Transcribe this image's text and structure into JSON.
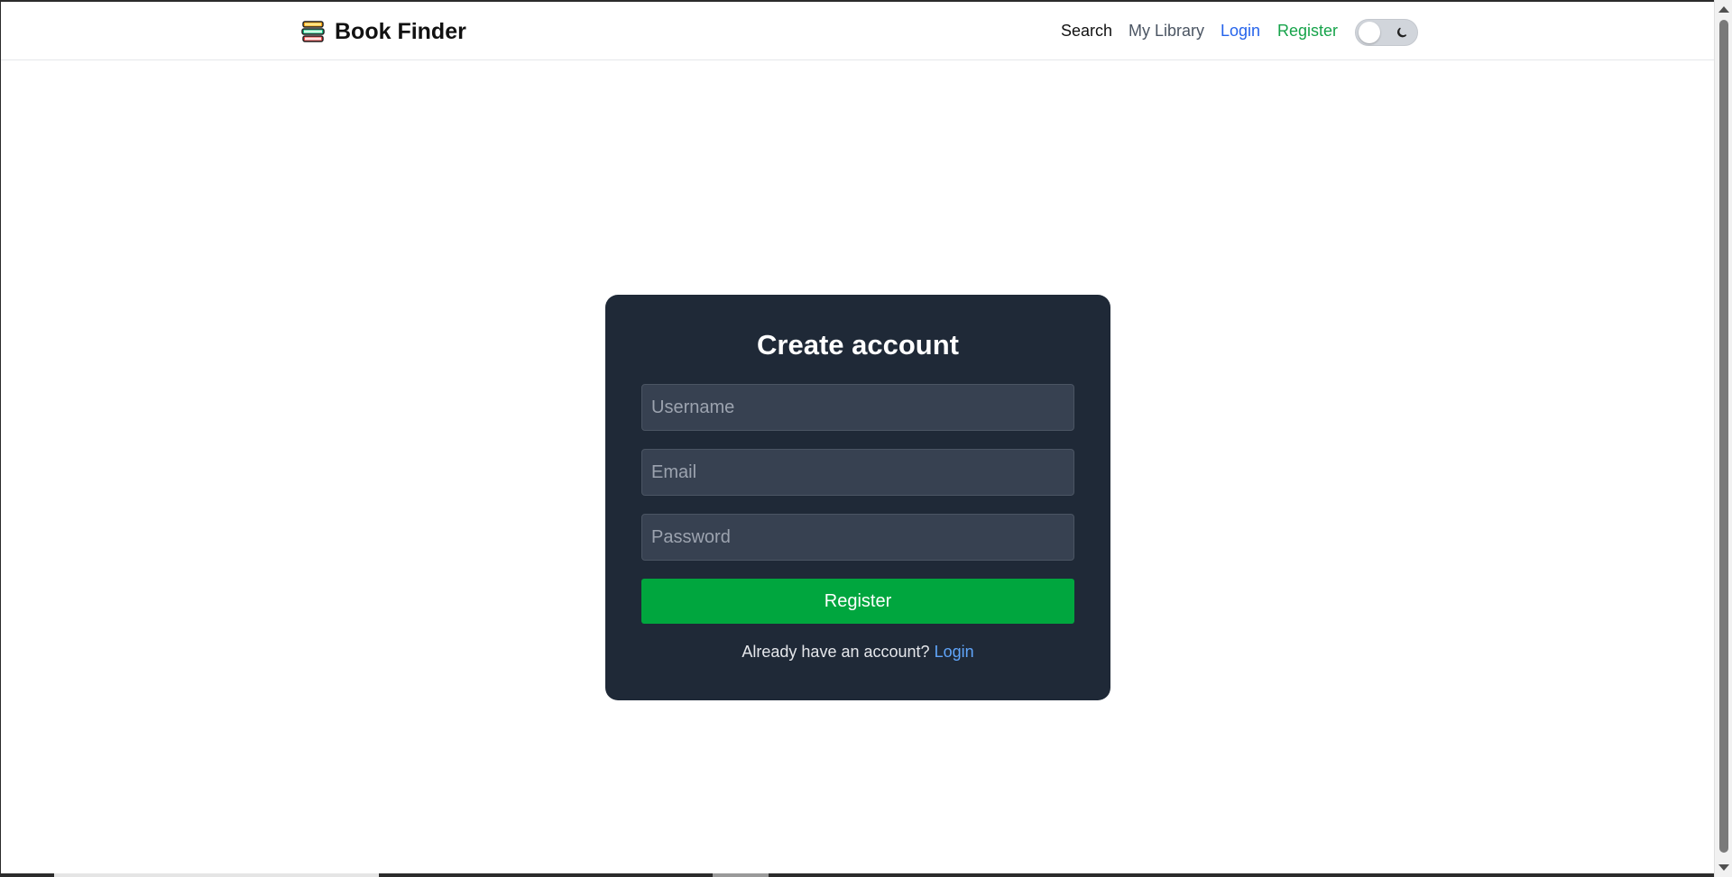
{
  "header": {
    "brand_name": "Book Finder",
    "brand_icon": "books-stack-icon",
    "nav": {
      "search": "Search",
      "my_library": "My Library",
      "login": "Login",
      "register": "Register"
    },
    "theme_toggle": {
      "icon": "moon-icon",
      "state": "light"
    }
  },
  "register_form": {
    "title": "Create account",
    "username_placeholder": "Username",
    "username_value": "",
    "email_placeholder": "Email",
    "email_value": "",
    "password_placeholder": "Password",
    "password_value": "",
    "submit_label": "Register",
    "footer_text": "Already have an account?",
    "footer_link": "Login"
  },
  "colors": {
    "card_background": "#1f2937",
    "submit_button": "#00a63e",
    "login_link": "#2563eb",
    "register_link": "#16a34a",
    "footer_link": "#60a5fa"
  }
}
